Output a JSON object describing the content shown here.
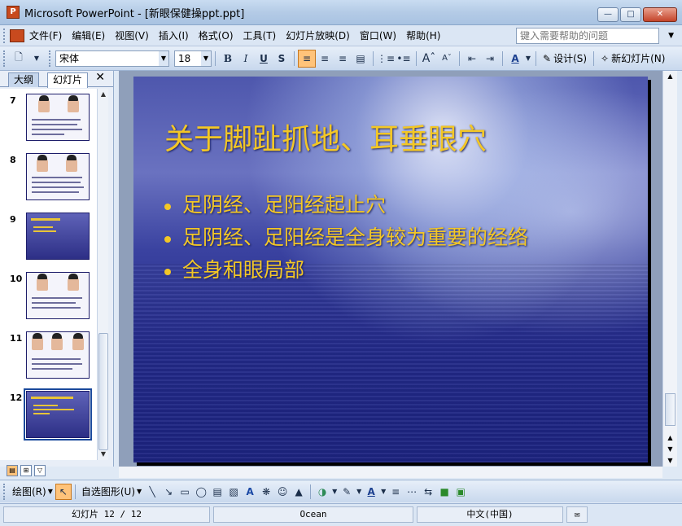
{
  "window": {
    "title": "Microsoft PowerPoint - [新眼保健操ppt.ppt]",
    "app_icon_label": "P"
  },
  "menu": {
    "items": [
      "文件(F)",
      "编辑(E)",
      "视图(V)",
      "插入(I)",
      "格式(O)",
      "工具(T)",
      "幻灯片放映(D)",
      "窗口(W)",
      "帮助(H)"
    ],
    "help_placeholder": "键入需要帮助的问题"
  },
  "toolbar": {
    "font_name": "宋体",
    "font_size": "18",
    "bold": "B",
    "italic": "I",
    "underline": "U",
    "shadow": "S",
    "design_label": "设计(S)",
    "new_slide_label": "新幻灯片(N)"
  },
  "panel": {
    "tab_outline": "大纲",
    "tab_slides": "幻灯片",
    "thumbnails": [
      {
        "number": "7",
        "style": "light"
      },
      {
        "number": "8",
        "style": "light"
      },
      {
        "number": "9",
        "style": "dark"
      },
      {
        "number": "10",
        "style": "light"
      },
      {
        "number": "11",
        "style": "light"
      },
      {
        "number": "12",
        "style": "dark",
        "selected": true
      }
    ]
  },
  "slide": {
    "title": "关于脚趾抓地、耳垂眼穴",
    "bullets": [
      "足阴经、足阳经起止穴",
      "足阴经、足阳经是全身较为重要的经络",
      "全身和眼局部"
    ],
    "title_color": "#f3c726"
  },
  "drawbar": {
    "draw_label": "绘图(R)",
    "autoshape_label": "自选图形(U)"
  },
  "status": {
    "slide_indicator": "幻灯片 12 / 12",
    "design_name": "Ocean",
    "language": "中文(中国)"
  }
}
